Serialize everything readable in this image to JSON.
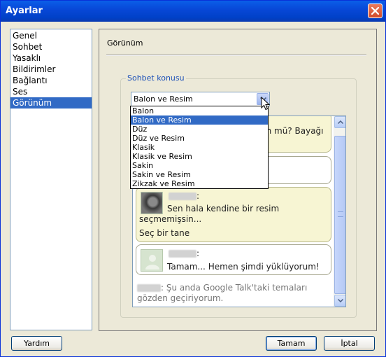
{
  "window": {
    "title": "Ayarlar"
  },
  "sidebar": {
    "items": [
      {
        "label": "Genel"
      },
      {
        "label": "Sohbet"
      },
      {
        "label": "Yasaklı"
      },
      {
        "label": "Bildirimler"
      },
      {
        "label": "Bağlantı"
      },
      {
        "label": "Ses"
      },
      {
        "label": "Görünüm"
      }
    ],
    "selected": "Görünüm"
  },
  "panel": {
    "title": "Görünüm",
    "group_label": "Sohbet konusu",
    "theme_select": {
      "value": "Balon ve Resim",
      "options": [
        "Balon",
        "Balon ve Resim",
        "Düz",
        "Düz ve Resim",
        "Klasik",
        "Klasik ve Resim",
        "Sakin",
        "Sakin ve Resim",
        "Zikzak ve Resim"
      ]
    }
  },
  "preview": {
    "partial_text": "ün mü? Bayağı",
    "message_2_line1": "Sen hala kendine bir resim",
    "message_2_line2": "seçmemişsin...",
    "message_2_line3": "Seç bir tane",
    "message_3": "Tamam... Hemen şimdi yüklüyorum!",
    "status": ": Şu anda Google Talk'taki temaları gözden geçiriyorum."
  },
  "buttons": {
    "help": "Yardım",
    "ok": "Tamam",
    "cancel": "İptal"
  }
}
